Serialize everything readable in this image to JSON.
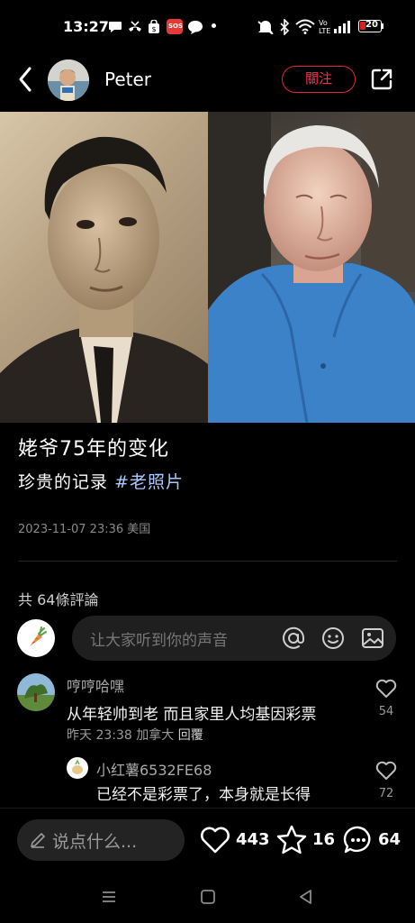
{
  "status_bar": {
    "time": "13:27",
    "sos_badge": "SOS",
    "battery": "20",
    "network": "Vo LTE"
  },
  "header": {
    "username": "Peter",
    "follow_label": "關注"
  },
  "post": {
    "title": "姥爷75年的变化",
    "description": "珍贵的记录",
    "hashtag": "#老照片",
    "meta": "2023-11-07 23:36 美国"
  },
  "comments_section": {
    "count_label": "共 64條評論",
    "input_placeholder": "让大家听到你的声音",
    "comments": [
      {
        "author": "哼哼哈嘿",
        "text": "从年轻帅到老 而且家里人均基因彩票",
        "meta": "昨天 23:38 加拿大",
        "reply_label": "回覆",
        "likes": "54"
      },
      {
        "author": "小红薯6532FE68",
        "text": "已经不是彩票了，本身就是长得",
        "likes": "72"
      }
    ]
  },
  "bottom_bar": {
    "say_placeholder": "说点什么...",
    "likes": "443",
    "favorites": "16",
    "comments": "64"
  },
  "colors": {
    "accent": "#ff2e4d",
    "hashtag": "#a9c8ff",
    "background": "#000000"
  }
}
